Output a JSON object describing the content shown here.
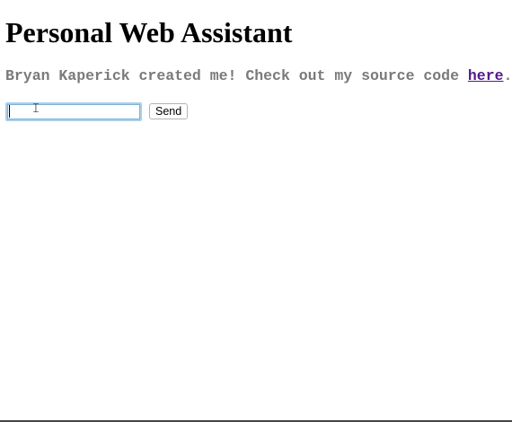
{
  "page": {
    "title": "Personal Web Assistant",
    "intro_prefix": "Bryan Kaperick created me! Check out my source code ",
    "intro_link": "here",
    "intro_suffix": "."
  },
  "chat_form": {
    "input_value": "",
    "send_label": "Send"
  },
  "cursor": {
    "icon": "text-cursor-icon",
    "glyph": "𝙸"
  }
}
